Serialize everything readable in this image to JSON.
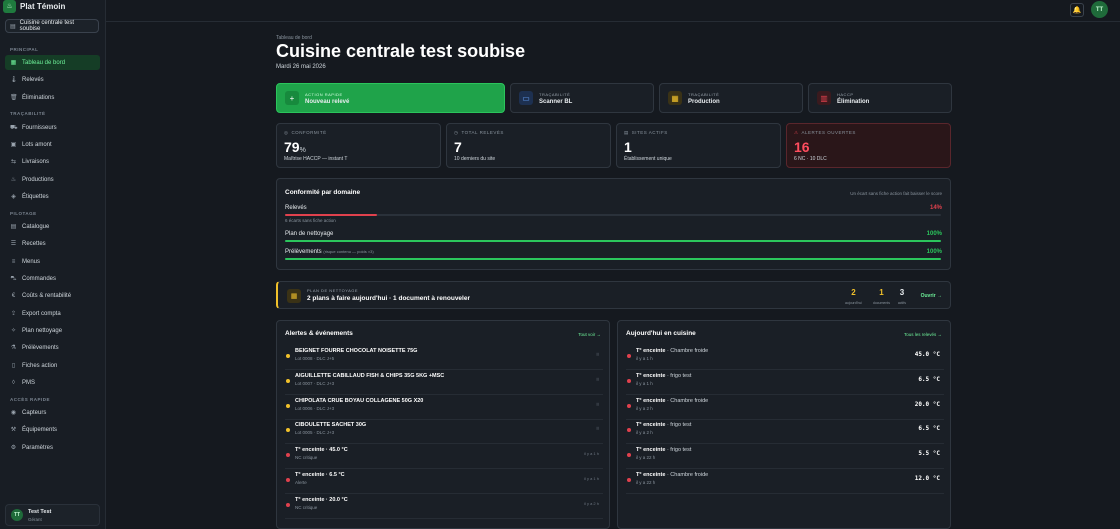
{
  "app": {
    "name": "Plat Témoin",
    "logo_icon": "chef-icon",
    "site": "Cuisine centrale test soubise"
  },
  "sidebar": {
    "sections": [
      {
        "title": "PRINCIPAL"
      },
      {
        "title": "TRAÇABILITÉ"
      },
      {
        "title": "PILOTAGE"
      },
      {
        "title": "ACCÈS RAPIDE"
      }
    ],
    "items": [
      {
        "label": "Tableau de bord",
        "icon": "grid-icon"
      },
      {
        "label": "Relevés",
        "icon": "thermometer-icon"
      },
      {
        "label": "Éliminations",
        "icon": "trash-icon"
      },
      {
        "label": "Fournisseurs",
        "icon": "truck-icon"
      },
      {
        "label": "Lots amont",
        "icon": "box-icon"
      },
      {
        "label": "Livraisons",
        "icon": "delivery-icon"
      },
      {
        "label": "Productions",
        "icon": "pot-icon"
      },
      {
        "label": "Étiquettes",
        "icon": "tag-icon"
      },
      {
        "label": "Catalogue",
        "icon": "book-icon"
      },
      {
        "label": "Recettes",
        "icon": "recipe-icon"
      },
      {
        "label": "Menus",
        "icon": "menu-icon"
      },
      {
        "label": "Commandes",
        "icon": "cart-icon"
      },
      {
        "label": "Coûts & rentabilité",
        "icon": "euro-icon"
      },
      {
        "label": "Export compta",
        "icon": "export-icon"
      },
      {
        "label": "Plan nettoyage",
        "icon": "broom-icon"
      },
      {
        "label": "Prélèvements",
        "icon": "flask-icon"
      },
      {
        "label": "Fiches action",
        "icon": "file-icon"
      },
      {
        "label": "PMS",
        "icon": "shield-icon"
      },
      {
        "label": "Capteurs",
        "icon": "sensor-icon"
      },
      {
        "label": "Équipements",
        "icon": "wrench-icon"
      },
      {
        "label": "Paramètres",
        "icon": "gear-icon"
      }
    ],
    "user": {
      "initials": "TT",
      "name": "Test Test",
      "role": "Gérant"
    }
  },
  "topbar": {
    "avatar": "TT"
  },
  "header": {
    "crumb": "Tableau de bord",
    "title": "Cuisine centrale test soubise",
    "date": "Mardi 26 mai 2026"
  },
  "quick_actions": [
    {
      "label": "ACTION RAPIDE",
      "title": "Nouveau relevé",
      "icon": "+"
    },
    {
      "label": "TRAÇABILITÉ",
      "title": "Scanner BL",
      "icon": "▭"
    },
    {
      "label": "TRAÇABILITÉ",
      "title": "Production",
      "icon": "▦"
    },
    {
      "label": "HACCP",
      "title": "Élimination",
      "icon": "▥"
    }
  ],
  "kpis": [
    {
      "label": "CONFORMITÉ",
      "value": "79",
      "unit": "%",
      "sub": "Maîtrise HACCP — instant T"
    },
    {
      "label": "TOTAL RELEVÉS",
      "value": "7",
      "unit": "",
      "sub": "10 derniers du site"
    },
    {
      "label": "SITES ACTIFS",
      "value": "1",
      "unit": "",
      "sub": "Établissement unique"
    },
    {
      "label": "ALERTES OUVERTES",
      "value": "16",
      "unit": "",
      "sub": "6 NC · 10 DLC"
    }
  ],
  "conformity": {
    "title": "Conformité par domaine",
    "right": "Un écart sans fiche action fait baisser le score",
    "domains": [
      {
        "label": "Relevés",
        "note": "",
        "sub": "6 écarts sans fiche action",
        "pct": "14%",
        "value": 14,
        "color": "#e0414d"
      },
      {
        "label": "Plan de nettoyage",
        "note": "",
        "sub": "",
        "pct": "100%",
        "value": 100,
        "color": "#2bc55c"
      },
      {
        "label": "Prélèvements",
        "note": "(risque contenu — poids ×3)",
        "sub": "",
        "pct": "100%",
        "value": 100,
        "color": "#2bc55c"
      }
    ]
  },
  "plan": {
    "label": "PLAN DE NETTOYAGE",
    "text": "2 plans à faire aujourd'hui · 1 document à renouveler",
    "stats": [
      {
        "value": "2",
        "label": "aujourd'hui",
        "color": "#f1c12b"
      },
      {
        "value": "1",
        "label": "documents",
        "color": "#f1c12b"
      },
      {
        "value": "3",
        "label": "actifs",
        "color": "#e8ecef"
      }
    ],
    "open": "Ouvrir →"
  },
  "alerts": {
    "title": "Alertes & événements",
    "link": "Tout voir →",
    "items": [
      {
        "title": "BEIGNET FOURRE CHOCOLAT NOISETTE 75G",
        "sub": "Lot 0008 · DLC J+5",
        "right": "⠿",
        "color": "#f1c12b"
      },
      {
        "title": "AIGUILLETTE CABILLAUD FISH & CHIPS 35G 5KG +MSC",
        "sub": "Lot 0007 · DLC J+3",
        "right": "⠿",
        "color": "#f1c12b"
      },
      {
        "title": "CHIPOLATA CRUE BOYAU COLLAGENE 50G X20",
        "sub": "Lot 0006 · DLC J+3",
        "right": "⠿",
        "color": "#f1c12b"
      },
      {
        "title": "CIBOULETTE SACHET 30G",
        "sub": "Lot 0005 · DLC J+3",
        "right": "⠿",
        "color": "#f1c12b"
      },
      {
        "title": "T° enceinte · 45.0 °C",
        "sub": "NC critique",
        "right": "il y a 1 h",
        "color": "#e0414d"
      },
      {
        "title": "T° enceinte · 6.5 °C",
        "sub": "Alerte",
        "right": "il y a 1 h",
        "color": "#e0414d"
      },
      {
        "title": "T° enceinte · 20.0 °C",
        "sub": "NC critique",
        "right": "il y a 2 h",
        "color": "#e0414d"
      }
    ]
  },
  "today": {
    "title": "Aujourd'hui en cuisine",
    "link": "Tous les relevés →",
    "items": [
      {
        "name": "T° enceinte",
        "place": "· Chambre froide",
        "sub": "il y a 1 h",
        "value": "45.0 °C",
        "color": "#e0414d"
      },
      {
        "name": "T° enceinte",
        "place": "· frigo test",
        "sub": "il y a 1 h",
        "value": "6.5 °C",
        "color": "#e0414d"
      },
      {
        "name": "T° enceinte",
        "place": "· Chambre froide",
        "sub": "il y a 2 h",
        "value": "20.0 °C",
        "color": "#e0414d"
      },
      {
        "name": "T° enceinte",
        "place": "· frigo test",
        "sub": "il y a 2 h",
        "value": "6.5 °C",
        "color": "#e0414d"
      },
      {
        "name": "T° enceinte",
        "place": "· frigo test",
        "sub": "il y a 22 h",
        "value": "5.5 °C",
        "color": "#e0414d"
      },
      {
        "name": "T° enceinte",
        "place": "· Chambre froide",
        "sub": "il y a 22 h",
        "value": "12.0 °C",
        "color": "#e0414d"
      }
    ]
  },
  "colors": {
    "accent": "#2bc55c",
    "danger": "#e0414d",
    "warning": "#f1c12b"
  }
}
